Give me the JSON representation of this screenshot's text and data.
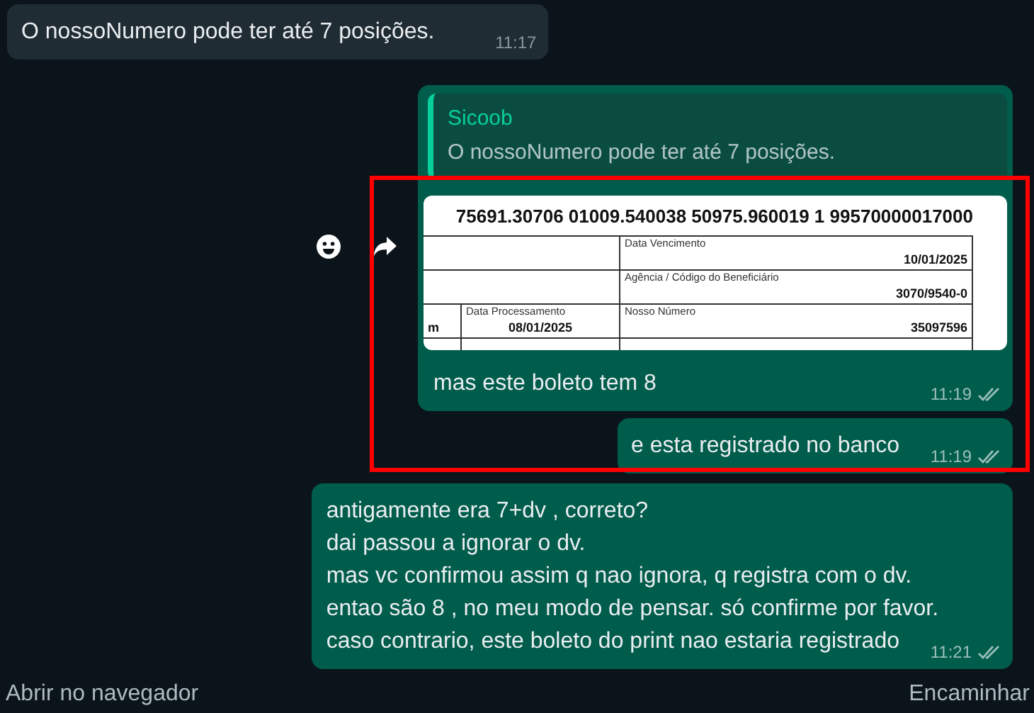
{
  "messages": [
    {
      "kind": "text",
      "outgoing": false,
      "text": "O nossoNumero pode ter até 7 posições.",
      "time": "11:17"
    },
    {
      "kind": "document_reply",
      "outgoing": true,
      "quote": {
        "author": "Sicoob",
        "text": "O nossoNumero pode ter até 7 posições."
      },
      "document": {
        "line": "75691.30706 01009.540038 50975.960019 1 99570000017000",
        "right_fields": [
          {
            "label": "Data Vencimento",
            "value": "10/01/2025"
          },
          {
            "label": "Agência / Código do Beneficiário",
            "value": "3070/9540-0"
          }
        ],
        "bottom_row": [
          {
            "value": "m"
          },
          {
            "label": "Data Processamento",
            "value": "08/01/2025"
          },
          {
            "label": "Nosso Número",
            "value": "35097596"
          }
        ]
      },
      "text": "mas este boleto tem 8",
      "time": "11:19",
      "delivered": true,
      "hover_actions": true,
      "highlighted": true
    },
    {
      "kind": "text",
      "outgoing": true,
      "text": "e esta registrado no banco",
      "time": "11:19",
      "delivered": true,
      "highlighted": true
    },
    {
      "kind": "text",
      "outgoing": true,
      "text": "antigamente era 7+dv , correto?\ndai passou a ignorar o dv.\nmas vc confirmou assim q nao ignora, q registra com o dv.\nentao são 8 , no meu modo de pensar. só confirme por favor.\ncaso contrario, este boleto do print nao estaria registrado",
      "time": "11:21",
      "delivered": true,
      "highlighted": false
    }
  ],
  "footer": {
    "left": "Abrir no navegador",
    "right": "Encaminhar"
  }
}
